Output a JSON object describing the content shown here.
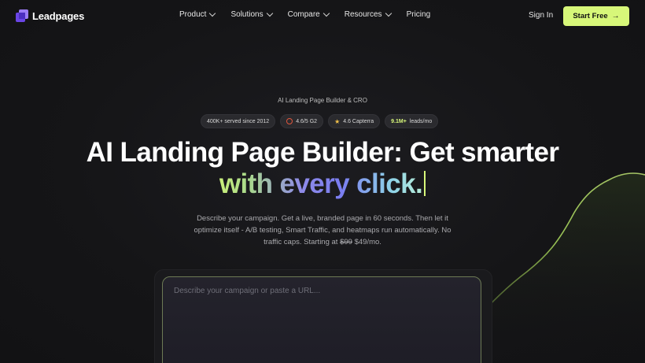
{
  "brand": {
    "name": "Leadpages",
    "accent": "#d7f779",
    "logo_color": "#7b5cf0"
  },
  "nav": {
    "items": [
      {
        "label": "Product",
        "has_dropdown": true
      },
      {
        "label": "Solutions",
        "has_dropdown": true
      },
      {
        "label": "Compare",
        "has_dropdown": true
      },
      {
        "label": "Resources",
        "has_dropdown": true
      },
      {
        "label": "Pricing",
        "has_dropdown": false
      }
    ],
    "signin_label": "Sign In",
    "cta_label": "Start Free",
    "cta_icon": "arrow-right-icon"
  },
  "hero": {
    "eyebrow": "AI Landing Page Builder & CRO",
    "badges": {
      "served": "400K+ served since 2012",
      "g2": "4.6/5 G2",
      "capterra": "4.6 Capterra",
      "leads_value": "9.1M+",
      "leads_label": "leads/mo"
    },
    "headline_line1": "AI Landing Page Builder: Get smarter",
    "headline_line2_plain": "with every click.",
    "subtext_1": "Describe your campaign. Get a live, branded page in 60 seconds. Then let it optimize itself - A/B testing, Smart Traffic, and heatmaps run automatically. No traffic caps. Starting at ",
    "old_price": "$99",
    "new_price": " $49/mo.",
    "prompt_placeholder": "Describe your campaign or paste a URL..."
  }
}
